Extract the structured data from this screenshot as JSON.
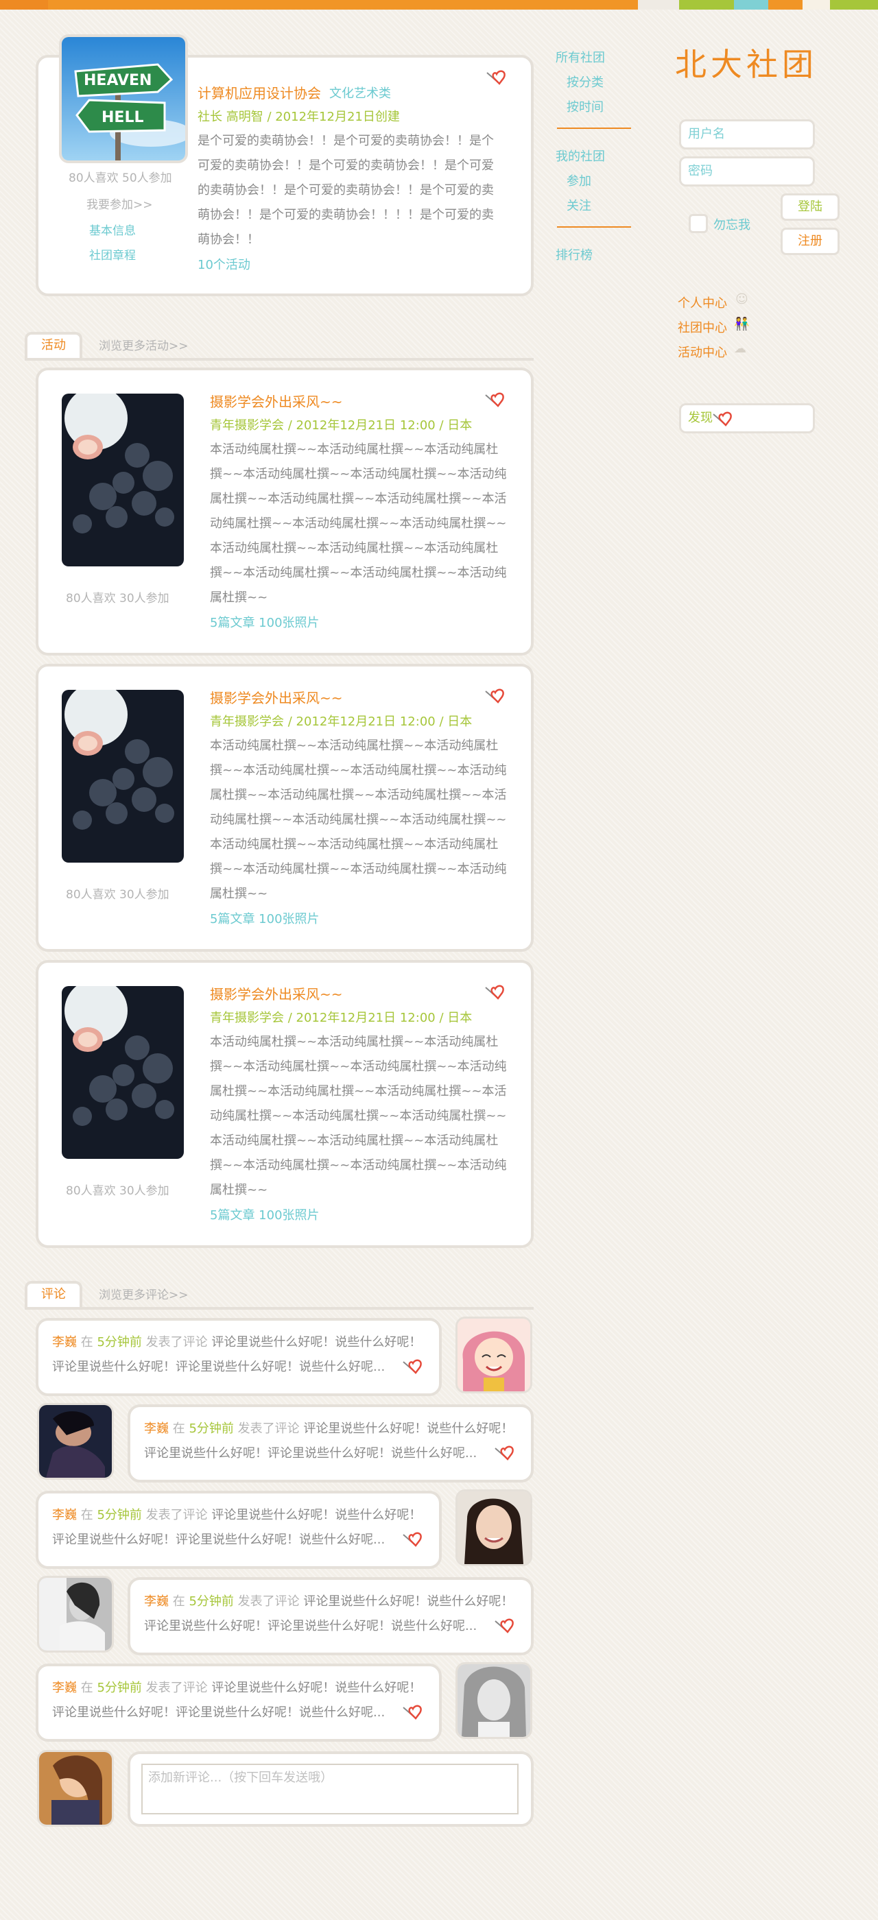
{
  "colors": {
    "orange": "#ee8a22",
    "green": "#a6c63a",
    "teal": "#6ccad0",
    "border": "#e5e0d9"
  },
  "logo": "北大社团",
  "club": {
    "name": "计算机应用设计协会",
    "category": "文化艺术类",
    "meta": "社长 高明智 / 2012年12月21日创建",
    "description": "是个可爱的卖萌协会！！是个可爱的卖萌协会！！是个可爱的卖萌协会！！是个可爱的卖萌协会！！是个可爱的卖萌协会！！是个可爱的卖萌协会！！是个可爱的卖萌协会！！是个可爱的卖萌协会！！！！是个可爱的卖萌协会！！",
    "activity_count": "10个活动",
    "stats": "80人喜欢 50人参加",
    "join": "我要参加>>",
    "basic_info": "基本信息",
    "charter": "社团章程",
    "image_sign_top": "HEAVEN",
    "image_sign_bottom": "HELL"
  },
  "nav": {
    "all": "所有社团",
    "by_category": "按分类",
    "by_time": "按时间",
    "my": "我的社团",
    "joined": "参加",
    "following": "关注",
    "ranking": "排行榜"
  },
  "login": {
    "username_placeholder": "用户名",
    "password_placeholder": "密码",
    "remember": "勿忘我",
    "login_btn": "登陆",
    "register_btn": "注册"
  },
  "centers": {
    "personal": "个人中心",
    "club": "社团中心",
    "activity": "活动中心"
  },
  "discover": "发现",
  "activities_section": {
    "tab": "活动",
    "more": "浏览更多活动>>"
  },
  "activities": [
    {
      "title": "摄影学会外出采风~~",
      "meta": "青年摄影学会 / 2012年12月21日 12:00 / 日本",
      "body": "本活动纯属杜撰~~本活动纯属杜撰~~本活动纯属杜撰~~本活动纯属杜撰~~本活动纯属杜撰~~本活动纯属杜撰~~本活动纯属杜撰~~本活动纯属杜撰~~本活动纯属杜撰~~本活动纯属杜撰~~本活动纯属杜撰~~本活动纯属杜撰~~本活动纯属杜撰~~本活动纯属杜撰~~本活动纯属杜撰~~本活动纯属杜撰~~本活动纯属杜撰~~",
      "stats": "80人喜欢  30人参加",
      "links": "5篇文章  100张照片"
    },
    {
      "title": "摄影学会外出采风~~",
      "meta": "青年摄影学会 / 2012年12月21日 12:00 / 日本",
      "body": "本活动纯属杜撰~~本活动纯属杜撰~~本活动纯属杜撰~~本活动纯属杜撰~~本活动纯属杜撰~~本活动纯属杜撰~~本活动纯属杜撰~~本活动纯属杜撰~~本活动纯属杜撰~~本活动纯属杜撰~~本活动纯属杜撰~~本活动纯属杜撰~~本活动纯属杜撰~~本活动纯属杜撰~~本活动纯属杜撰~~本活动纯属杜撰~~本活动纯属杜撰~~",
      "stats": "80人喜欢  30人参加",
      "links": "5篇文章  100张照片"
    },
    {
      "title": "摄影学会外出采风~~",
      "meta": "青年摄影学会 / 2012年12月21日 12:00 / 日本",
      "body": "本活动纯属杜撰~~本活动纯属杜撰~~本活动纯属杜撰~~本活动纯属杜撰~~本活动纯属杜撰~~本活动纯属杜撰~~本活动纯属杜撰~~本活动纯属杜撰~~本活动纯属杜撰~~本活动纯属杜撰~~本活动纯属杜撰~~本活动纯属杜撰~~本活动纯属杜撰~~本活动纯属杜撰~~本活动纯属杜撰~~本活动纯属杜撰~~本活动纯属杜撰~~",
      "stats": "80人喜欢  30人参加",
      "links": "5篇文章  100张照片"
    }
  ],
  "comments_section": {
    "tab": "评论",
    "more": "浏览更多评论>>"
  },
  "comments": [
    {
      "author": "李巍",
      "at": "在",
      "time": "5分钟前",
      "action": "发表了评论",
      "text": "评论里说些什么好呢！说些什么好呢！评论里说些什么好呢！评论里说些什么好呢！说些什么好呢..."
    },
    {
      "author": "李巍",
      "at": "在",
      "time": "5分钟前",
      "action": "发表了评论",
      "text": "评论里说些什么好呢！说些什么好呢！评论里说些什么好呢！评论里说些什么好呢！说些什么好呢..."
    },
    {
      "author": "李巍",
      "at": "在",
      "time": "5分钟前",
      "action": "发表了评论",
      "text": "评论里说些什么好呢！说些什么好呢！评论里说些什么好呢！评论里说些什么好呢！说些什么好呢..."
    },
    {
      "author": "李巍",
      "at": "在",
      "time": "5分钟前",
      "action": "发表了评论",
      "text": "评论里说些什么好呢！说些什么好呢！评论里说些什么好呢！评论里说些什么好呢！说些什么好呢..."
    },
    {
      "author": "李巍",
      "at": "在",
      "time": "5分钟前",
      "action": "发表了评论",
      "text": "评论里说些什么好呢！说些什么好呢！评论里说些什么好呢！评论里说些什么好呢！说些什么好呢..."
    }
  ],
  "new_comment_placeholder": "添加新评论...（按下回车发送哦）"
}
